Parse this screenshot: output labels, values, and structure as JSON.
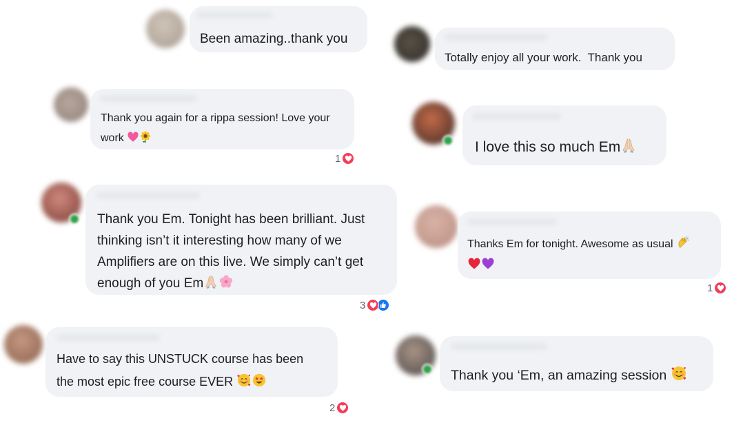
{
  "comments": [
    {
      "text": "Been amazing..thank you",
      "reactions": null
    },
    {
      "text": "Totally enjoy all your work.  Thank you",
      "reactions": null
    },
    {
      "line1": "Thank you again for a rippa session! Love your",
      "line2": "work",
      "line2_emojis": [
        "pink-heart",
        "sunflower"
      ],
      "reactions": {
        "count": "1",
        "types": [
          "love"
        ]
      }
    },
    {
      "text": "I love this so much Em",
      "emojis": [
        "folded-hands"
      ],
      "reactions": null
    },
    {
      "line1": "Thank you Em. Tonight has been brilliant. Just",
      "line2": "thinking isn’t it interesting how many of we",
      "line3": "Amplifiers are on this live. We simply can’t get",
      "line4": "enough of you Em",
      "line4_emojis": [
        "folded-hands",
        "cherry-blossom"
      ],
      "reactions": {
        "count": "3",
        "types": [
          "love",
          "like"
        ]
      }
    },
    {
      "line1": "Thanks Em for tonight. Awesome as usual",
      "line1_emojis": [
        "clapping-hands"
      ],
      "line2_emojis": [
        "red-heart",
        "purple-heart"
      ],
      "reactions": {
        "count": "1",
        "types": [
          "love"
        ]
      }
    },
    {
      "line1": "Have to say this UNSTUCK course has been",
      "line2": "the most epic free course EVER",
      "line2_emojis": [
        "smiling-face-with-hearts",
        "star-struck"
      ],
      "reactions": {
        "count": "2",
        "types": [
          "love"
        ]
      }
    },
    {
      "text": "Thank you ‘Em, an amazing session",
      "emojis": [
        "smiling-face-with-hearts"
      ],
      "reactions": null
    }
  ],
  "colors": {
    "bubble": "#f0f2f5",
    "text": "#1c1e21",
    "love": "#f33e58",
    "like": "#1877f2",
    "count": "#65676b"
  }
}
